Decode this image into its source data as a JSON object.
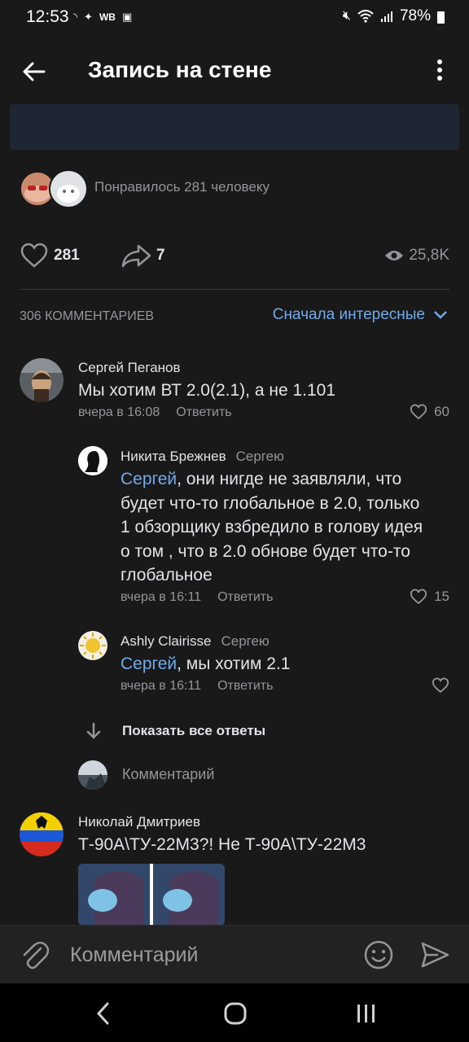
{
  "status": {
    "time": "12:53",
    "wb": "WB",
    "battery": "78%"
  },
  "header": {
    "title": "Запись на стене"
  },
  "likes_summary": {
    "text": "Понравилось 281 человеку"
  },
  "stats": {
    "likes": "281",
    "shares": "7",
    "views": "25,8K"
  },
  "comments_header": {
    "count_label": "306 КОММЕНТАРИЕВ",
    "sort_label": "Сначала интересные"
  },
  "comments": [
    {
      "author": "Сергей Пеганов",
      "text": "Мы хотим ВТ 2.0(2.1), а не 1.101",
      "time": "вчера в 16:08",
      "reply": "Ответить",
      "likes": "60"
    },
    {
      "author": "Никита Брежнев",
      "reply_to": "Сергею",
      "mention": "Сергей",
      "text_lines": [
        ", они нигде не заявляли, что",
        "будет что-то глобальное в 2.0, только",
        "1 обзорщику взбредило в голову идея",
        "о том , что в 2.0 обнове будет что-то",
        "глобальное"
      ],
      "time": "вчера в 16:11",
      "reply": "Ответить",
      "likes": "15"
    },
    {
      "author": "Ashly Clairisse",
      "reply_to": "Сергею",
      "mention": "Сергей",
      "text": ", мы хотим 2.1",
      "time": "вчера в 16:11",
      "reply": "Ответить"
    },
    {
      "author": "Николай Дмитриев",
      "text": "Т-90А\\ТУ-22М3?! Не Т-90А\\ТУ-22М3"
    }
  ],
  "show_all_replies": "Показать все ответы",
  "reply_input_placeholder": "Комментарий",
  "bottom_input_placeholder": "Комментарий",
  "colors": {
    "background": "#19191a",
    "accent": "#71aaeb",
    "muted": "#939699"
  }
}
